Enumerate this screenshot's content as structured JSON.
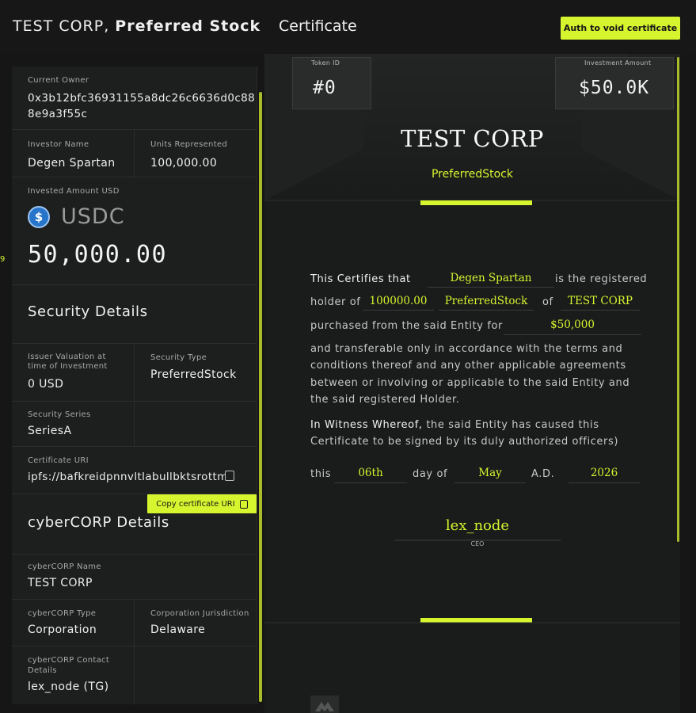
{
  "header": {
    "title_prefix": "TEST CORP,",
    "title_bold": "Preferred Stock",
    "cert_label": "Certificate",
    "auth_button": "Auth to void certificate"
  },
  "left": {
    "edge_mark": "9",
    "current_owner": {
      "label": "Current Owner",
      "value_line1": "0x3b12bfc36931155a8dc26c6636d0c88",
      "value_line2": "8e9a3f55c"
    },
    "investor_name": {
      "label": "Investor Name",
      "value": "Degen Spartan"
    },
    "units": {
      "label": "Units Represented",
      "value": "100,000.00"
    },
    "invested": {
      "label": "Invested Amount USD",
      "currency": "USDC",
      "currency_icon": "usdc-icon",
      "amount": "50,000.00"
    },
    "security_title": "Security Details",
    "issuer_valuation": {
      "label_line1": "Issuer Valuation at",
      "label_line2": "time of Investment",
      "value": "0 USD"
    },
    "security_type": {
      "label": "Security Type",
      "value": "PreferredStock"
    },
    "security_series": {
      "label": "Security Series",
      "value": "SeriesA"
    },
    "certificate_uri": {
      "label": "Certificate URI",
      "value": "ipfs://bafkreidpnnvltlabullbktsrottm..."
    },
    "copy_uri_button": "Copy certificate URI",
    "cybercorp_title": "cyberCORP Details",
    "cybercorp_name": {
      "label": "cyberCORP Name",
      "value": "TEST CORP"
    },
    "cybercorp_type": {
      "label": "cyberCORP Type",
      "value": "Corporation"
    },
    "jurisdiction": {
      "label": "Corporation Jurisdiction",
      "value": "Delaware"
    },
    "contact": {
      "label_line1": "cyberCORP Contact",
      "label_line2": "Details",
      "value": "lex_node (TG)"
    }
  },
  "certificate": {
    "token_id_label": "Token ID",
    "token_id": "#0",
    "investment_label": "Investment Amount",
    "investment_amount": "$50.0K",
    "corp_name": "TEST CORP",
    "security_type": "PreferredStock",
    "text": {
      "certifies": "This Certifies that",
      "is_registered": "is the registered",
      "holder_of": "holder of",
      "of": "of",
      "purchased": "purchased from the said Entity for",
      "para1_l1": "and transferable only in accordance with the terms and",
      "para1_l2": "conditions thereof and any other applicable agreements",
      "para1_l3": "between or involving or applicable to the said Entity and",
      "para1_l4": "the said registered Holder.",
      "witness_bold": "In Witness Whereof,",
      "witness_rest": " the said Entity has caused this",
      "witness_l2": "Certificate to be signed by its duly authorized officers)",
      "this": "this",
      "day_of": "day of",
      "ad": "A.D."
    },
    "fills": {
      "holder": "Degen Spartan",
      "units": "100000.00",
      "security": "PreferredStock",
      "corp": "TEST CORP",
      "price": "$50,000",
      "day": "06th",
      "month": "May",
      "year": "2026"
    },
    "signer": "lex_node",
    "signer_title": "CEO"
  },
  "colors": {
    "accent": "#d6f52f",
    "background": "#161616",
    "panel": "#1d1e1e",
    "usdc": "#2775ca"
  }
}
